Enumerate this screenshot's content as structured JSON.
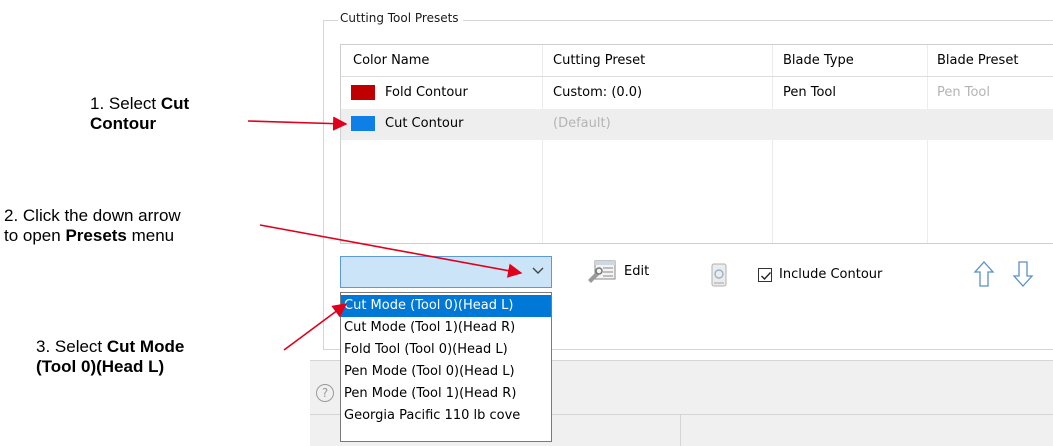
{
  "instructions": {
    "step1": {
      "prefix": "1. Select ",
      "bold_line1": "Cut",
      "bold_line2": "Contour"
    },
    "step2": {
      "line1": "2. Click the down arrow",
      "line2_prefix": "to open ",
      "line2_bold": "Presets",
      "line2_suffix": " menu"
    },
    "step3": {
      "line1_prefix": "3. Select ",
      "line1_bold": "Cut Mode",
      "line2_bold": "(Tool 0)(Head L)"
    }
  },
  "group": {
    "title": "Cutting Tool Presets"
  },
  "table": {
    "columns": [
      "Color Name",
      "Cutting Preset",
      "Blade Type",
      "Blade Preset"
    ],
    "rows": [
      {
        "color": "#c00000",
        "name": "Fold Contour",
        "cutting_preset": "Custom: (0.0)",
        "blade_type": "Pen Tool",
        "blade_preset": "Pen Tool",
        "selected": false
      },
      {
        "color": "#0f7fe8",
        "name": "Cut Contour",
        "cutting_preset": "(Default)",
        "blade_type": "",
        "blade_preset": "",
        "selected": true
      }
    ]
  },
  "toolbar": {
    "edit_label": "Edit",
    "include_contour_label": "Include Contour",
    "include_contour_checked": true
  },
  "presets_dropdown": {
    "options": [
      "Cut Mode (Tool 0)(Head L)",
      "Cut Mode (Tool 1)(Head R)",
      "Fold Tool (Tool 0)(Head L)",
      "Pen Mode (Tool 0)(Head L)",
      "Pen Mode (Tool 1)(Head R)",
      "Georgia Pacific 110 lb cove"
    ],
    "highlighted_index": 0
  },
  "icons": {
    "edit": "edit-settings-icon",
    "recycle": "recycle-bin-icon",
    "move_up": "arrow-up-icon",
    "move_down": "arrow-down-icon",
    "help": "help-icon",
    "combo_arrow": "chevron-down-icon"
  },
  "colors": {
    "annotation_arrow": "#e0001b",
    "highlight": "#0078d7",
    "combo_bg": "#cce4f7"
  }
}
